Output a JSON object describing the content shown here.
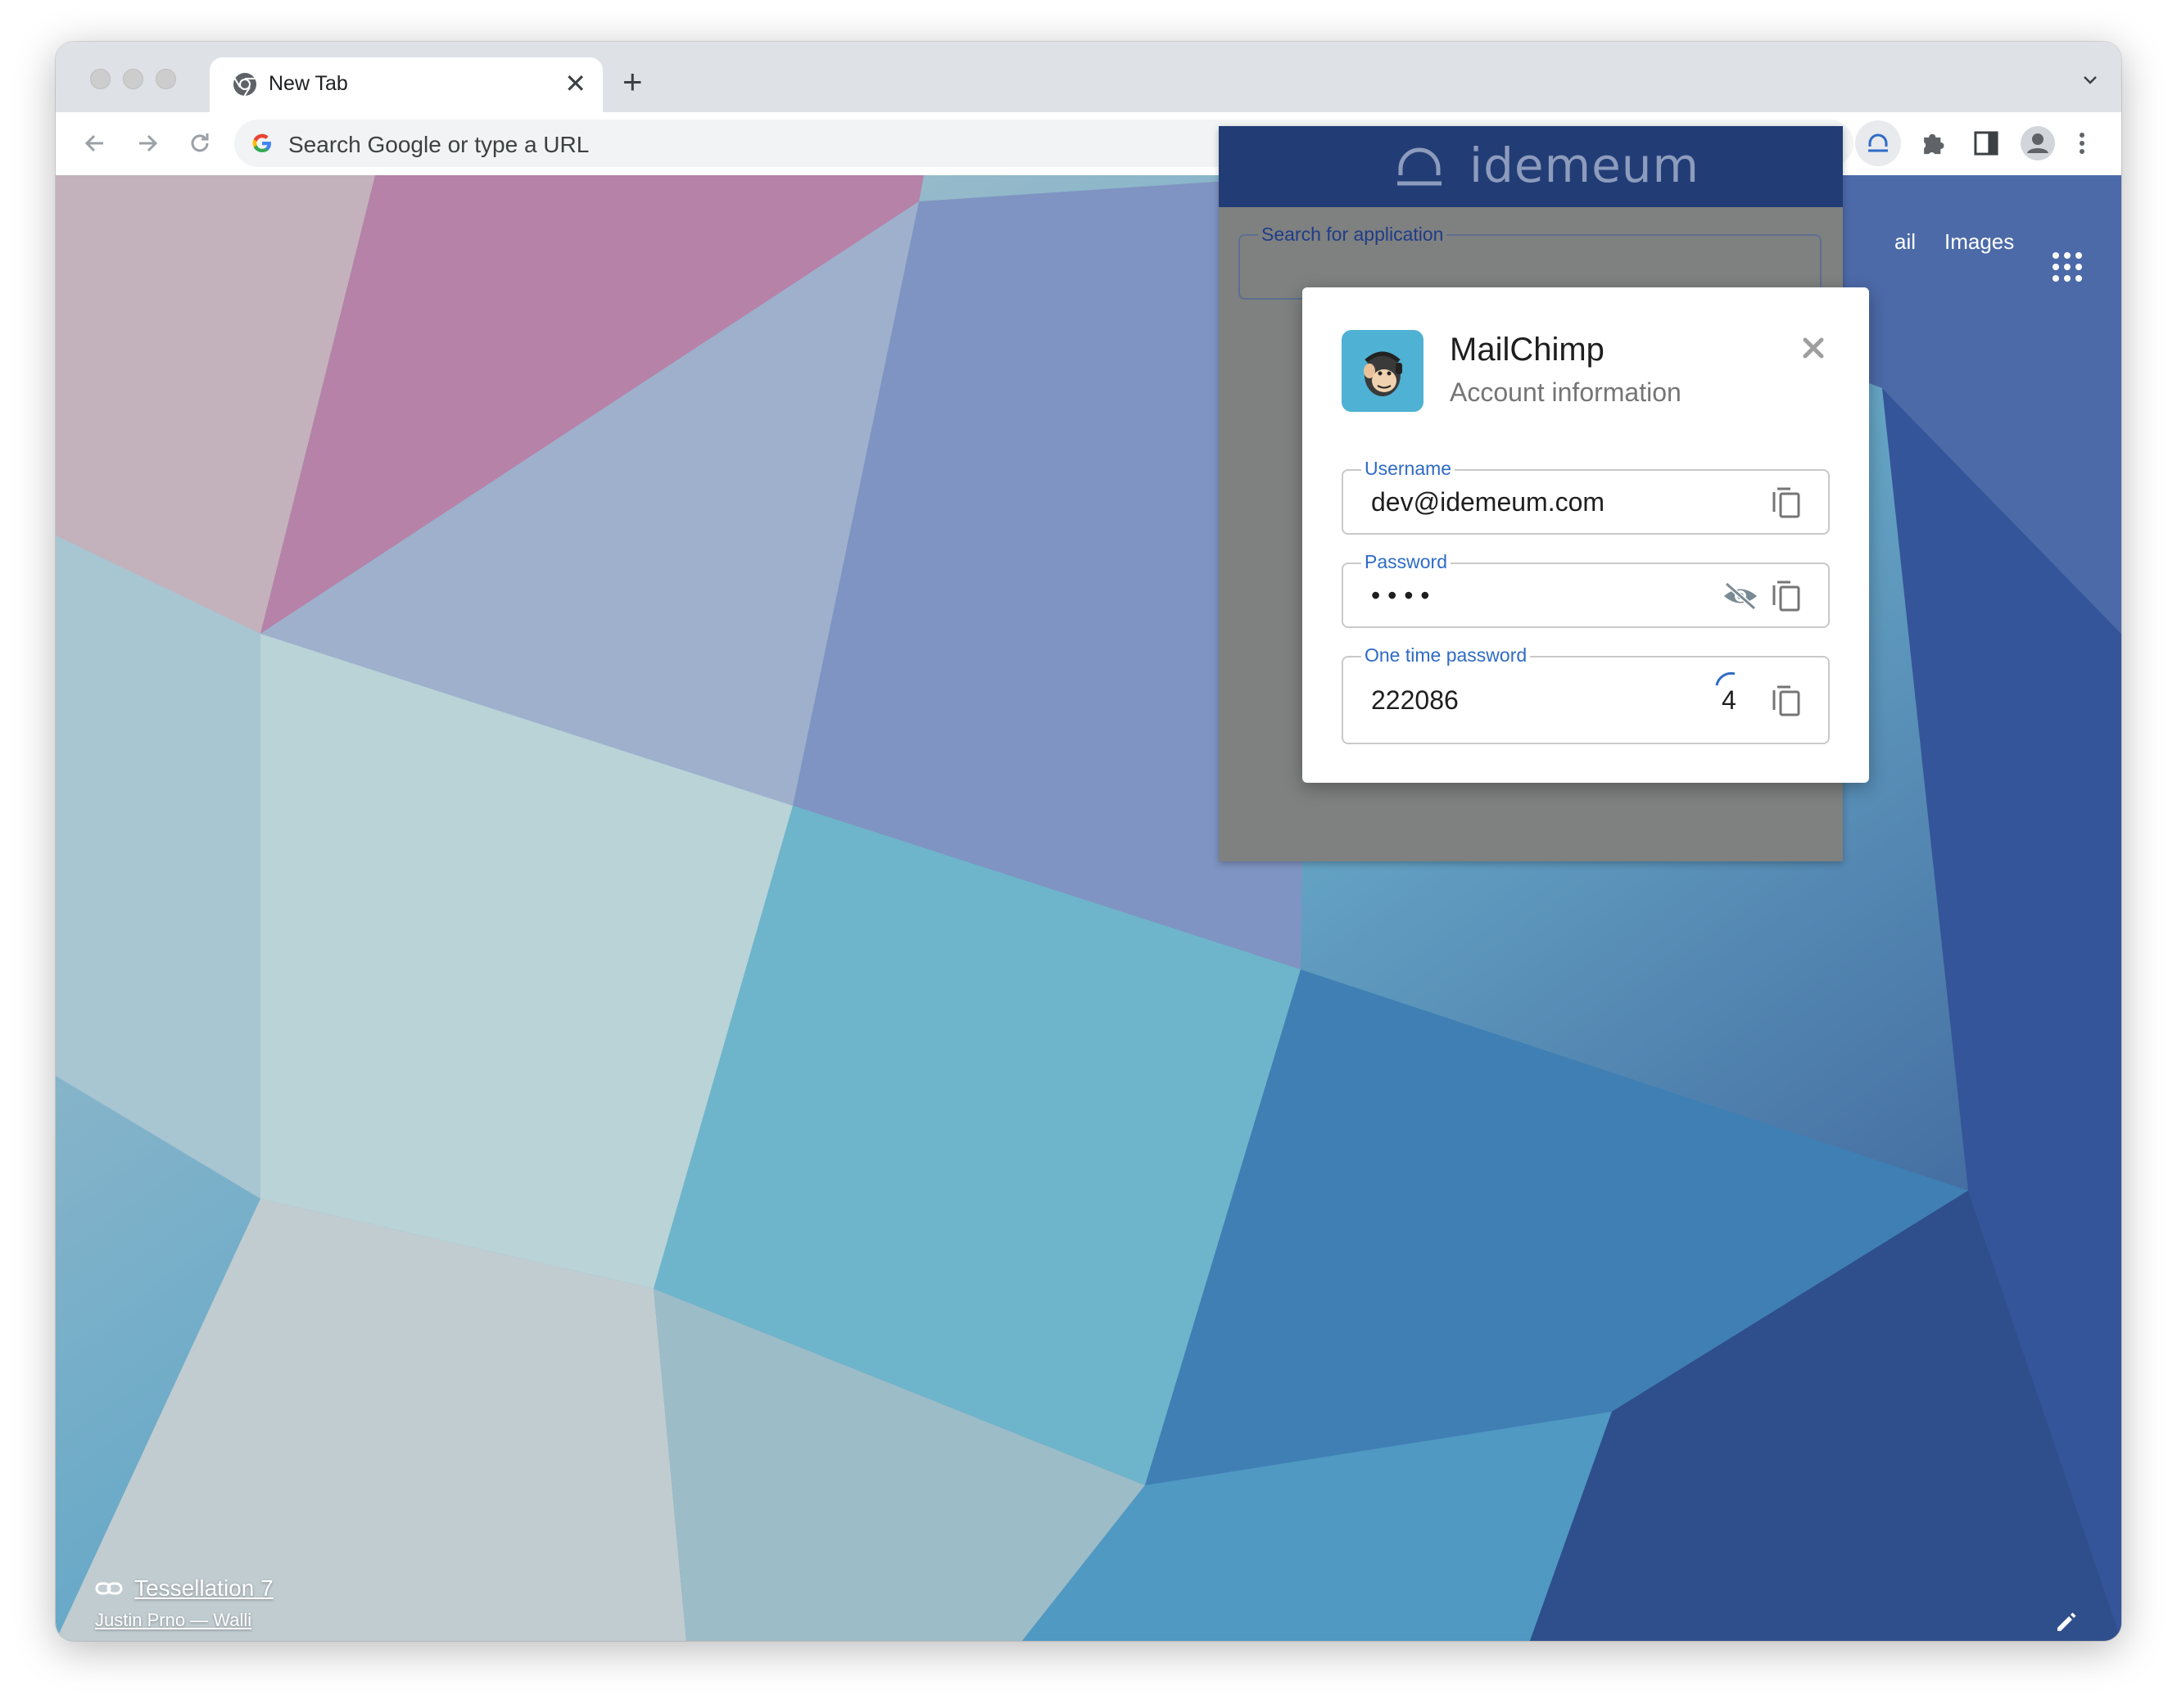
{
  "browser": {
    "tab_title": "New Tab",
    "omnibox_placeholder": "Search Google or type a URL"
  },
  "newtab": {
    "gmail_label_partial": "ail",
    "images_label": "Images",
    "attribution_title": "Tessellation 7",
    "attribution_subtitle": "Justin Prno — Walli"
  },
  "extension": {
    "brand": "idemeum",
    "search_label": "Search for application",
    "colors": {
      "header": "#223d75",
      "overlay": "#7f8080",
      "accent": "#2e6bc6"
    }
  },
  "dialog": {
    "app_name": "MailChimp",
    "subtitle": "Account information",
    "fields": {
      "username": {
        "label": "Username",
        "value": "dev@idemeum.com"
      },
      "password": {
        "label": "Password",
        "value": "• • • •"
      },
      "otp": {
        "label": "One time password",
        "value": "222086",
        "seconds_left": "4"
      }
    }
  }
}
